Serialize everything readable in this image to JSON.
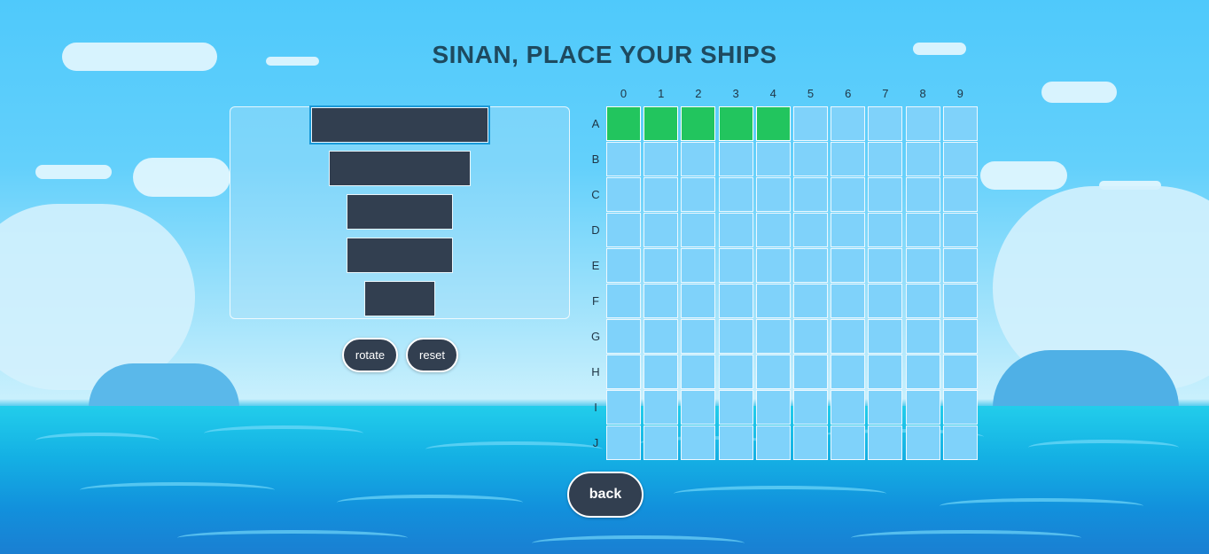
{
  "title": "SINAN, PLACE YOUR SHIPS",
  "controls": {
    "rotate_label": "rotate",
    "reset_label": "reset",
    "back_label": "back"
  },
  "board": {
    "columns": [
      "0",
      "1",
      "2",
      "3",
      "4",
      "5",
      "6",
      "7",
      "8",
      "9"
    ],
    "rows": [
      "A",
      "B",
      "C",
      "D",
      "E",
      "F",
      "G",
      "H",
      "I",
      "J"
    ],
    "placed_cells": [
      "A0",
      "A1",
      "A2",
      "A3",
      "A4"
    ],
    "empty_color": "#7fd2fa",
    "placed_color": "#22c55e"
  },
  "ships": [
    {
      "size": 5,
      "selected": true
    },
    {
      "size": 4,
      "selected": false
    },
    {
      "size": 3,
      "selected": false
    },
    {
      "size": 3,
      "selected": false
    },
    {
      "size": 2,
      "selected": false
    }
  ],
  "colors": {
    "ship": "#323f50",
    "title": "#1e4a5f",
    "selection": "#1a9ad8"
  }
}
